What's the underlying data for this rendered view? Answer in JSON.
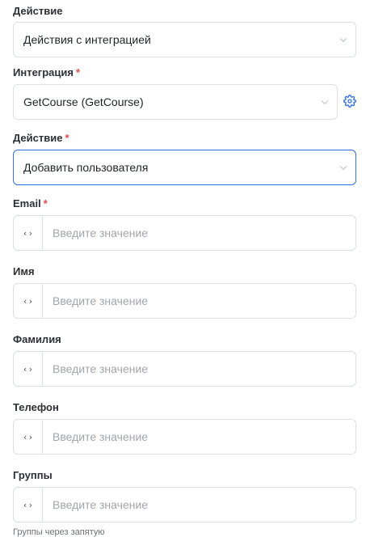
{
  "action_type": {
    "label": "Действие",
    "value": "Действия с интеграцией"
  },
  "integration": {
    "label": "Интеграция",
    "required_mark": "*",
    "value": "GetCourse (GetCourse)",
    "settings_icon": "gear-icon"
  },
  "action": {
    "label": "Действие",
    "required_mark": "*",
    "value": "Добавить пользователя"
  },
  "fields": [
    {
      "label": "Email",
      "required_mark": "*",
      "code_icon": "‹›",
      "placeholder": "Введите значение"
    },
    {
      "label": "Имя",
      "code_icon": "‹›",
      "placeholder": "Введите значение"
    },
    {
      "label": "Фамилия",
      "code_icon": "‹›",
      "placeholder": "Введите значение"
    },
    {
      "label": "Телефон",
      "code_icon": "‹›",
      "placeholder": "Введите значение"
    },
    {
      "label": "Группы",
      "code_icon": "‹›",
      "placeholder": "Введите значение",
      "hint": "Группы через запятую"
    }
  ],
  "colors": {
    "accent": "#2f6fe4",
    "required": "#e5484d",
    "border": "#dcdfe6",
    "placeholder": "#a0a5ad"
  }
}
